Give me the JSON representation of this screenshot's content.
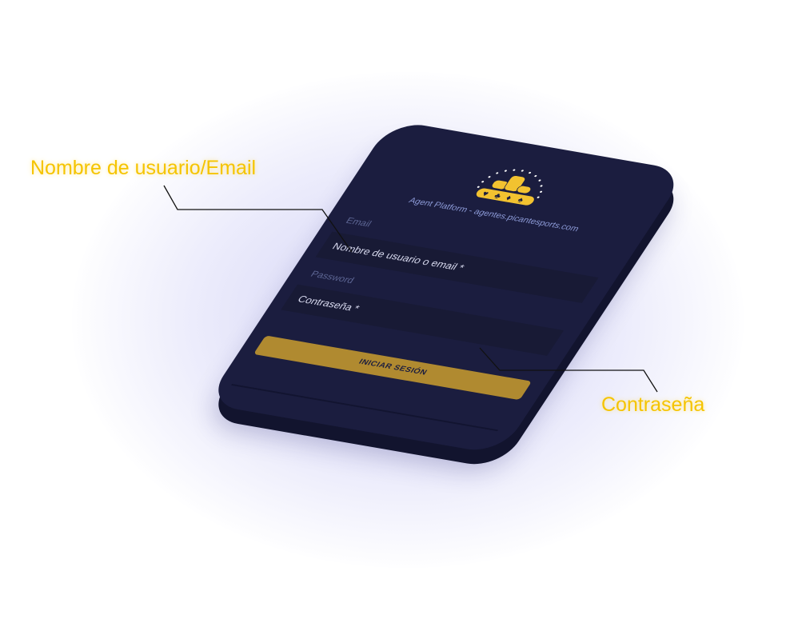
{
  "card": {
    "platform_text": "Agent Platform - agentes.picantesports.com",
    "email_label": "Email",
    "email_placeholder": "Nombre de usuario o email *",
    "password_label": "Password",
    "password_placeholder": "Contraseña *",
    "login_button": "INICIAR SESIÓN",
    "logo_icon": "poker-chips-logo"
  },
  "callouts": {
    "username": "Nombre de usuario/Email",
    "password": "Contraseña"
  },
  "colors": {
    "card": "#1b1d3f",
    "accent": "#b08a30",
    "callout": "#f5c400"
  }
}
